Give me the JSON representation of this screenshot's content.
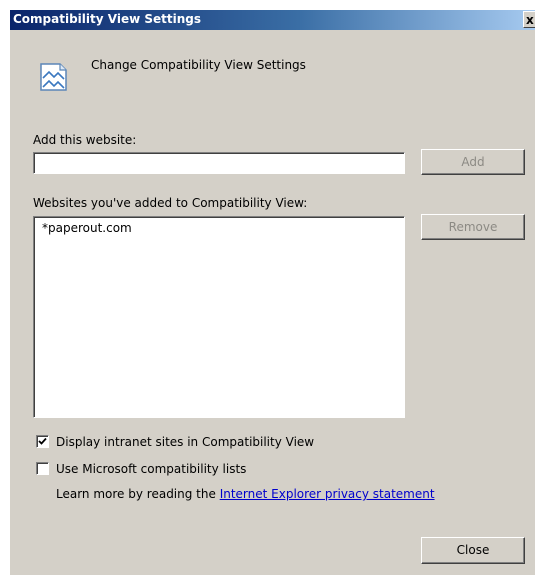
{
  "window": {
    "title": "Compatibility View Settings",
    "close_glyph": "x"
  },
  "header": {
    "icon": "compatibility-view-icon",
    "text": "Change Compatibility View Settings"
  },
  "add_section": {
    "label": "Add this website:",
    "input_value": "",
    "add_button": "Add",
    "add_button_enabled": false
  },
  "list_section": {
    "label": "Websites you've added to Compatibility View:",
    "items": [
      "*paperout.com"
    ],
    "remove_button": "Remove",
    "remove_button_enabled": false
  },
  "options": {
    "intranet": {
      "label": "Display intranet sites in Compatibility View",
      "checked": true
    },
    "ms_lists": {
      "label": "Use Microsoft compatibility lists",
      "checked": false
    }
  },
  "learn_more": {
    "prefix": "Learn more by reading the ",
    "link_text": "Internet Explorer privacy statement"
  },
  "footer": {
    "close_button": "Close"
  },
  "colors": {
    "dialog_face": "#d4d0c8",
    "title_start": "#0a246a",
    "title_end": "#a6caf0",
    "link": "#0000cc"
  }
}
